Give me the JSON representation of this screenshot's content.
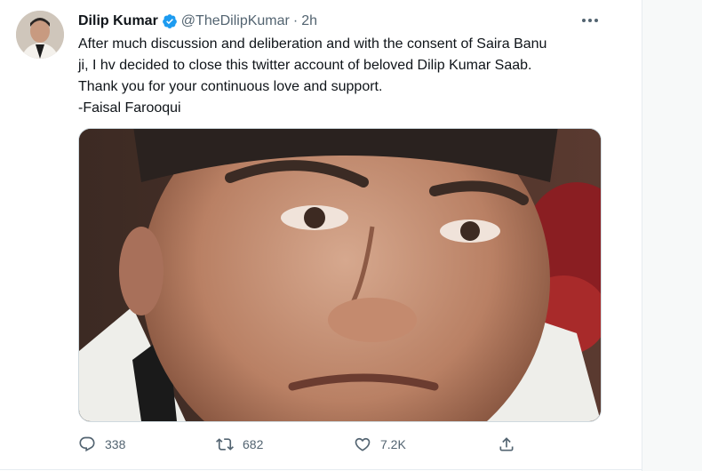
{
  "tweet": {
    "author_name": "Dilip Kumar",
    "handle": "@TheDilipKumar",
    "separator": "·",
    "time": "2h",
    "lines": [
      "After much discussion and deliberation and with the consent of Saira Banu",
      "ji, I hv decided to close this twitter account of beloved Dilip Kumar Saab.",
      "Thank you for your continuous love and support.",
      "-Faisal Farooqui"
    ],
    "media_icon": "portrait-photo",
    "accent_color": "#1d9bf0"
  },
  "actions": {
    "reply_count": "338",
    "retweet_count": "682",
    "like_count": "7.2K",
    "icons": [
      "reply-icon",
      "retweet-icon",
      "like-icon",
      "share-icon"
    ]
  }
}
